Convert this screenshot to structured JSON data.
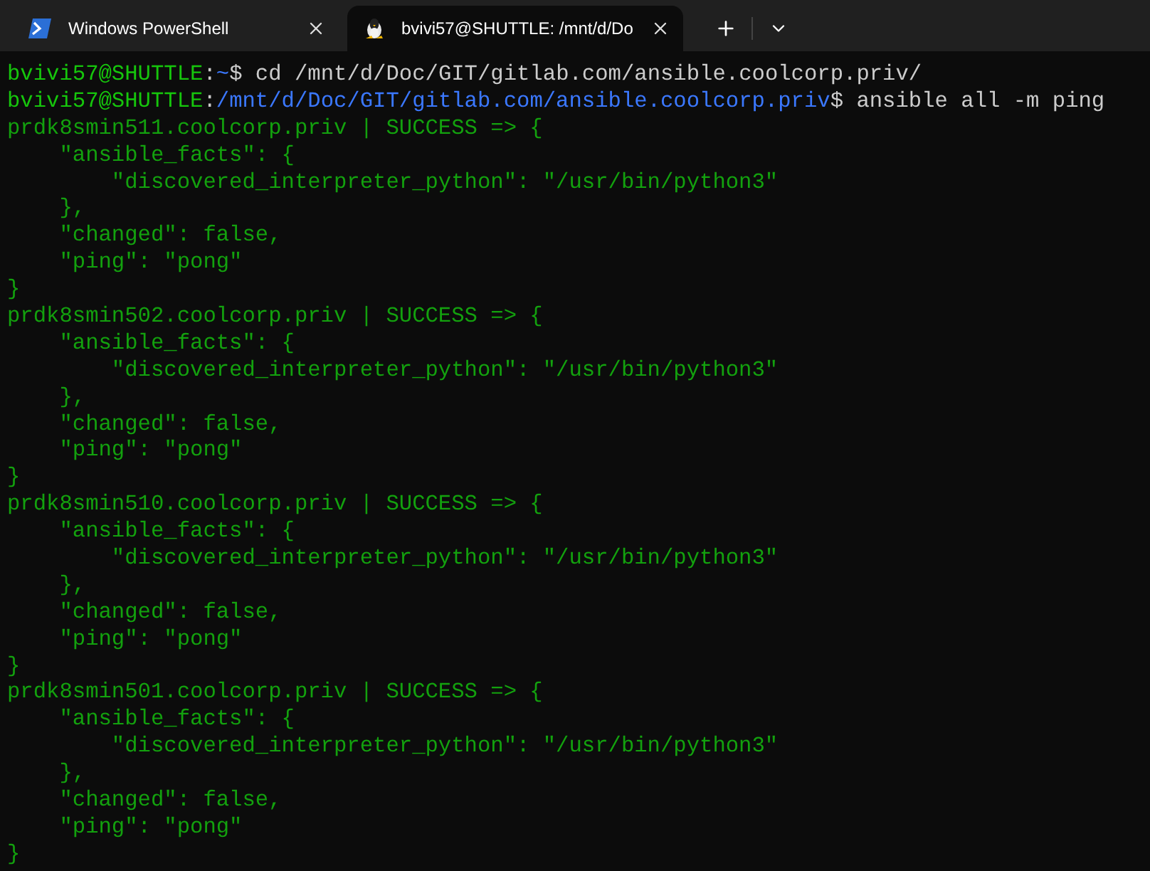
{
  "tabs": [
    {
      "title": "Windows PowerShell",
      "kind": "powershell",
      "selected": false
    },
    {
      "title": "bvivi57@SHUTTLE: /mnt/d/Do",
      "kind": "linux",
      "selected": true
    }
  ],
  "terminal": {
    "lines": [
      {
        "kind": "prompt",
        "user": "bvivi57@SHUTTLE",
        "separator": ":",
        "path": "~",
        "command": "$ cd /mnt/d/Doc/GIT/gitlab.com/ansible.coolcorp.priv/"
      },
      {
        "kind": "prompt",
        "user": "bvivi57@SHUTTLE",
        "separator": ":",
        "path": "/mnt/d/Doc/GIT/gitlab.com/ansible.coolcorp.priv",
        "command": "$ ansible all -m ping"
      },
      {
        "kind": "output",
        "text": "prdk8smin511.coolcorp.priv | SUCCESS => {"
      },
      {
        "kind": "output",
        "text": "    \"ansible_facts\": {"
      },
      {
        "kind": "output",
        "text": "        \"discovered_interpreter_python\": \"/usr/bin/python3\""
      },
      {
        "kind": "output",
        "text": "    },"
      },
      {
        "kind": "output",
        "text": "    \"changed\": false,"
      },
      {
        "kind": "output",
        "text": "    \"ping\": \"pong\""
      },
      {
        "kind": "output",
        "text": "}"
      },
      {
        "kind": "output",
        "text": "prdk8smin502.coolcorp.priv | SUCCESS => {"
      },
      {
        "kind": "output",
        "text": "    \"ansible_facts\": {"
      },
      {
        "kind": "output",
        "text": "        \"discovered_interpreter_python\": \"/usr/bin/python3\""
      },
      {
        "kind": "output",
        "text": "    },"
      },
      {
        "kind": "output",
        "text": "    \"changed\": false,"
      },
      {
        "kind": "output",
        "text": "    \"ping\": \"pong\""
      },
      {
        "kind": "output",
        "text": "}"
      },
      {
        "kind": "output",
        "text": "prdk8smin510.coolcorp.priv | SUCCESS => {"
      },
      {
        "kind": "output",
        "text": "    \"ansible_facts\": {"
      },
      {
        "kind": "output",
        "text": "        \"discovered_interpreter_python\": \"/usr/bin/python3\""
      },
      {
        "kind": "output",
        "text": "    },"
      },
      {
        "kind": "output",
        "text": "    \"changed\": false,"
      },
      {
        "kind": "output",
        "text": "    \"ping\": \"pong\""
      },
      {
        "kind": "output",
        "text": "}"
      },
      {
        "kind": "output",
        "text": "prdk8smin501.coolcorp.priv | SUCCESS => {"
      },
      {
        "kind": "output",
        "text": "    \"ansible_facts\": {"
      },
      {
        "kind": "output",
        "text": "        \"discovered_interpreter_python\": \"/usr/bin/python3\""
      },
      {
        "kind": "output",
        "text": "    },"
      },
      {
        "kind": "output",
        "text": "    \"changed\": false,"
      },
      {
        "kind": "output",
        "text": "    \"ping\": \"pong\""
      },
      {
        "kind": "output",
        "text": "}"
      }
    ]
  }
}
